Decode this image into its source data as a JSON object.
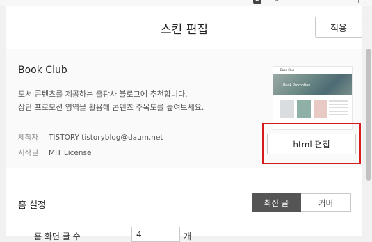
{
  "browser": {
    "tab_count": "2"
  },
  "header": {
    "title": "스킨 편집",
    "apply_label": "적용"
  },
  "skin": {
    "name": "Book Club",
    "description_line1": "도서 콘텐츠를 제공하는 출판사 블로그에 추천합니다.",
    "description_line2": "상단 프로모션 영역을 활용해 콘텐츠 주목도를 높여보세요.",
    "maker_label": "제작자",
    "maker_value": "TISTORY tistoryblog@daum.net",
    "license_label": "저작권",
    "license_value": "MIT License",
    "html_edit_label": "html 편집",
    "thumbnail": {
      "logo": "Book Club",
      "hero_text": "Book Promotion"
    }
  },
  "home_settings": {
    "title": "홈 설정",
    "tabs": [
      {
        "label": "최신 글",
        "active": true
      },
      {
        "label": "커버",
        "active": false
      }
    ],
    "post_count_label": "홈 화면 글 수",
    "post_count_value": "4",
    "post_count_unit": "개"
  },
  "colors": {
    "highlight": "#d71a1a",
    "active_tab": "#555555"
  }
}
